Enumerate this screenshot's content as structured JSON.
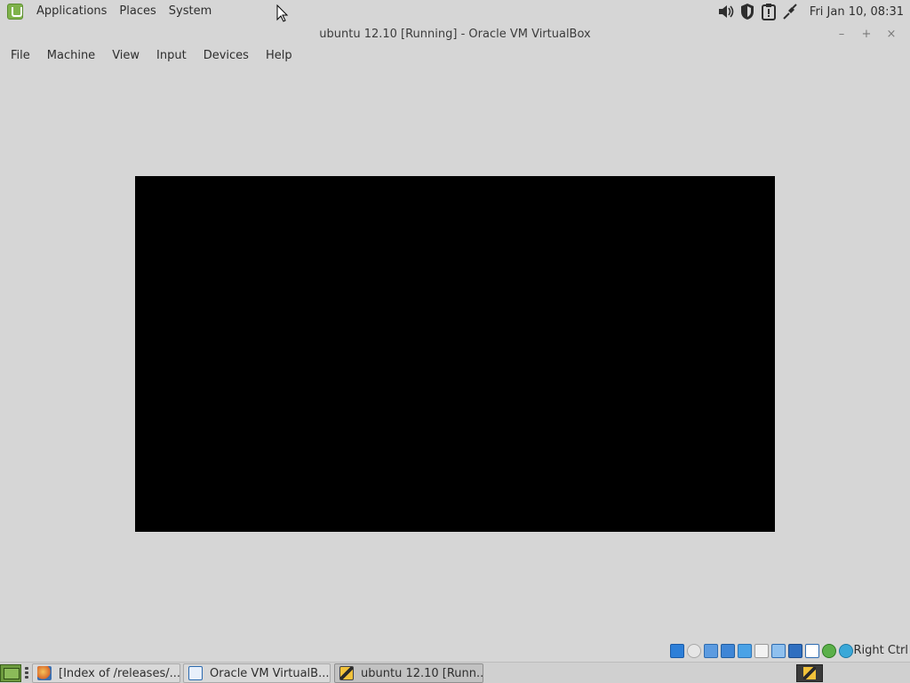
{
  "top_panel": {
    "menus": [
      "Applications",
      "Places",
      "System"
    ],
    "clock": "Fri Jan 10, 08:31",
    "tray_icons": [
      "volume-icon",
      "shield-icon",
      "clipboard-alert-icon",
      "network-icon"
    ]
  },
  "window": {
    "title": "ubuntu 12.10 [Running] - Oracle VM VirtualBox",
    "minimize_label": "–",
    "maximize_label": "+",
    "close_label": "×"
  },
  "menubar": {
    "items": [
      "File",
      "Machine",
      "View",
      "Input",
      "Devices",
      "Help"
    ]
  },
  "statusbar": {
    "host_key": "Right Ctrl",
    "icons": [
      "hard-disk-icon",
      "optical-disk-icon",
      "audio-icon",
      "network-icon",
      "usb-icon",
      "shared-folders-icon",
      "display-icon",
      "video-capture-icon",
      "virtualization-icon",
      "mouse-integration-icon",
      "keyboard-icon"
    ]
  },
  "taskbar": {
    "tasks": [
      {
        "label": "[Index of /releases/...",
        "icon": "firefox-icon"
      },
      {
        "label": "Oracle VM VirtualB...",
        "icon": "virtualbox-icon"
      },
      {
        "label": "ubuntu 12.10 [Runn...",
        "icon": "virtualbox-vm-icon"
      }
    ]
  },
  "colors": {
    "panel_bg": "#d6d6d6",
    "vm_screen": "#000000",
    "mint_green": "#7fb24a"
  }
}
